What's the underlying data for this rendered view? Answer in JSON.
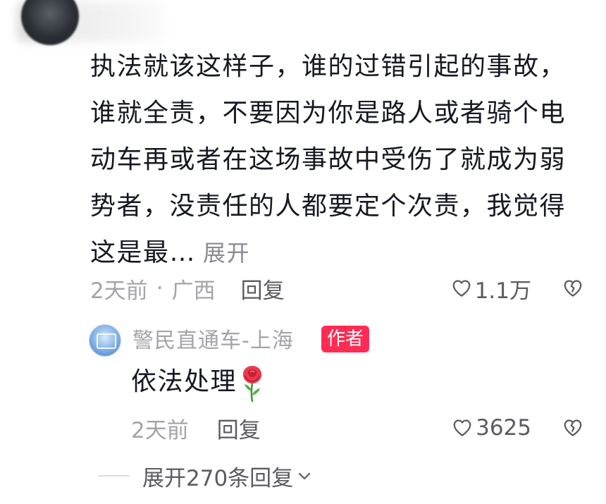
{
  "comment": {
    "text": "执法就该这样子，谁的过错引起的事故，谁就全责，不要因为你是路人或者骑个电动车再或者在这场事故中受伤了就成为弱势者，没责任的人都要定个次责，我觉得这是最…",
    "expand_label": "展开",
    "time": "2天前",
    "separator": "·",
    "location": "广西",
    "reply_label": "回复",
    "like_count": "1.1万"
  },
  "author_reply": {
    "name": "警民直通车-上海",
    "badge": "作者",
    "text": "依法处理",
    "time": "2天前",
    "reply_label": "回复",
    "like_count": "3625"
  },
  "expand_replies": {
    "label": "展开270条回复"
  },
  "icons": {
    "like": "heart-outline-icon",
    "dislike": "broken-heart-outline-icon",
    "rose": "rose-emoji-icon",
    "chevron": "chevron-down-icon"
  },
  "colors": {
    "text": "#161823",
    "secondary": "#a3a4a8",
    "action": "#5b5c61",
    "author_badge": "#fe2c55"
  }
}
